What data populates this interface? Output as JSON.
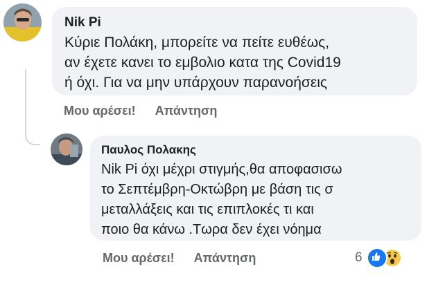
{
  "comments": [
    {
      "author": "Nik Pi",
      "lines": [
        "Κύριε Πολάκη, μπορείτε να πείτε ευθέως,",
        "αν έχετε κανει το εμβολιο κατα της Covid19",
        "ή όχι. Για να μην υπάρχουν παρανοήσεις"
      ],
      "like_label": "Μου αρέσει!",
      "reply_label": "Απάντηση"
    },
    {
      "author": "Παυλος Πολακης",
      "lines": [
        "Nik Pi όχι μέχρι στιγμής,θα αποφασισω",
        "το Σεπτέμβρη-Οκτώβρη με βάση τις σ",
        "μεταλλάξεις και τις επιπλοκές τι και",
        "ποιο θα κάνω .Τωρα δεν έχει νόημα"
      ],
      "like_label": "Μου αρέσει!",
      "reply_label": "Απάντηση",
      "reaction_count": "6",
      "reaction_icons": [
        "like-icon",
        "wow-icon"
      ]
    }
  ],
  "colors": {
    "bubble": "#f0f2f5",
    "action_text": "#65676b",
    "like_blue": "#1877f2",
    "wow_yellow": "#f7c94a"
  }
}
